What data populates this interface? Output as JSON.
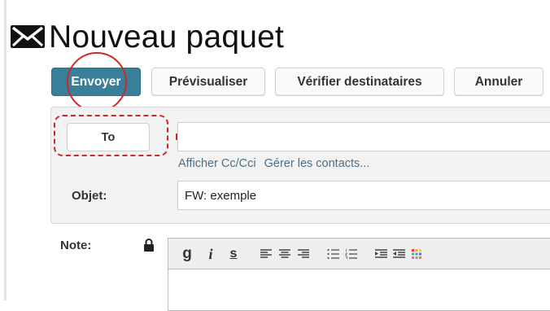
{
  "header": {
    "title": "Nouveau paquet",
    "icon": "mail-icon"
  },
  "toolbar": {
    "send_label": "Envoyer",
    "preview_label": "Prévisualiser",
    "check_label": "Vérifier destinataires",
    "cancel_label": "Annuler"
  },
  "form": {
    "to_label": "To",
    "to_value": "",
    "show_cc_label": "Afficher Cc/Cci",
    "manage_contacts_label": "Gérer les contacts...",
    "subject_label": "Objet:",
    "subject_value": "FW: exemple"
  },
  "note": {
    "label": "Note:",
    "lock_icon": "lock-icon",
    "toolbar_icons": [
      "bold-icon",
      "italic-icon",
      "strikethrough-icon",
      "align-left-icon",
      "align-center-icon",
      "align-right-icon",
      "bulleted-list-icon",
      "numbered-list-icon",
      "indent-icon",
      "outdent-icon",
      "color-picker-icon"
    ],
    "bold_glyph": "g",
    "italic_glyph": "i",
    "strike_glyph": "s"
  },
  "colors": {
    "primary_button": "#3a7f99",
    "annotation_red": "#cc2a2a",
    "link": "#4f6f88"
  }
}
